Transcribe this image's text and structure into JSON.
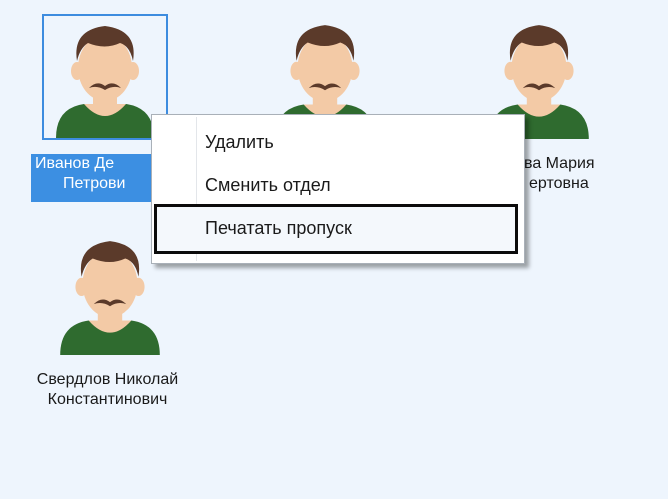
{
  "people": [
    {
      "name_line1": "Иванов Денис",
      "name_line2": "Петрович",
      "selected": true,
      "icon": "person-avatar-icon"
    },
    {
      "name_line1": "",
      "name_line2": "",
      "selected": false,
      "icon": "person-avatar-icon"
    },
    {
      "name_line1": "Иванова Мария",
      "name_line2": "Робертовна",
      "selected": false,
      "icon": "person-avatar-icon"
    },
    {
      "name_line1": "Свердлов Николай",
      "name_line2": "Константинович",
      "selected": false,
      "icon": "person-avatar-icon"
    }
  ],
  "visible_labels": {
    "p1_line1": "Иванов Де",
    "p1_line2": "Петрови",
    "p3_line1": "ва Мария",
    "p3_line2": "ертовна"
  },
  "context_menu": {
    "items": [
      {
        "label": "Удалить"
      },
      {
        "label": "Сменить отдел"
      },
      {
        "label": "Печатать пропуск",
        "highlighted": true
      }
    ]
  },
  "colors": {
    "background": "#eef5fd",
    "selection": "#3c8fe2",
    "hair": "#5b3a2a",
    "skin": "#f3caa6",
    "shirt": "#2f6b2f"
  }
}
